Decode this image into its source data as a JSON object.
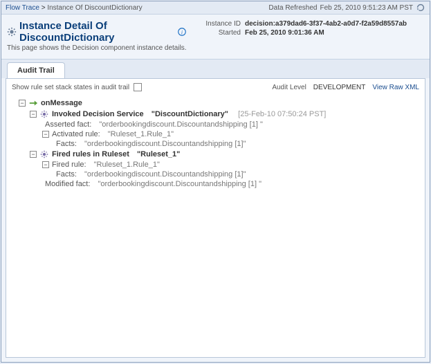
{
  "breadcrumb": {
    "flow_trace": "Flow Trace",
    "sep": ">",
    "current": "Instance Of DiscountDictionary"
  },
  "refresh": {
    "label": "Data Refreshed",
    "timestamp": "Feb 25, 2010 9:51:23 AM PST"
  },
  "header": {
    "title": "Instance Detail Of DiscountDictionary",
    "subtitle": "This page shows the Decision component instance details.",
    "instance_id_label": "Instance ID",
    "instance_id": "decision:a379dad6-3f37-4ab2-a0d7-f2a59d8557ab",
    "started_label": "Started",
    "started": "Feb 25, 2010 9:01:36 AM"
  },
  "tabs": {
    "audit_trail": "Audit Trail"
  },
  "controls": {
    "stack_check_label": "Show rule set stack states in audit trail",
    "audit_level_label": "Audit Level",
    "audit_level_value": "DEVELOPMENT",
    "view_raw_xml": "View Raw XML"
  },
  "tree": {
    "root": {
      "label": "onMessage"
    },
    "invoked": {
      "label": "Invoked Decision Service",
      "name": "\"DiscountDictionary\"",
      "timestamp": "[25-Feb-10 07:50:24 PST]"
    },
    "asserted": {
      "label": "Asserted fact:",
      "value": "\"orderbookingdiscount.Discountandshipping [1] \""
    },
    "activated": {
      "label": "Activated rule:",
      "value": "\"Ruleset_1.Rule_1\""
    },
    "activated_facts": {
      "label": "Facts:",
      "value": "\"orderbookingdiscount.Discountandshipping [1]\""
    },
    "fired_ruleset": {
      "label": "Fired rules in Ruleset",
      "name": "\"Ruleset_1\""
    },
    "fired_rule": {
      "label": "Fired rule:",
      "value": "\"Ruleset_1.Rule_1\""
    },
    "fired_facts": {
      "label": "Facts:",
      "value": "\"orderbookingdiscount.Discountandshipping [1]\""
    },
    "modified": {
      "label": "Modified fact:",
      "value": "\"orderbookingdiscount.Discountandshipping [1] \""
    }
  }
}
